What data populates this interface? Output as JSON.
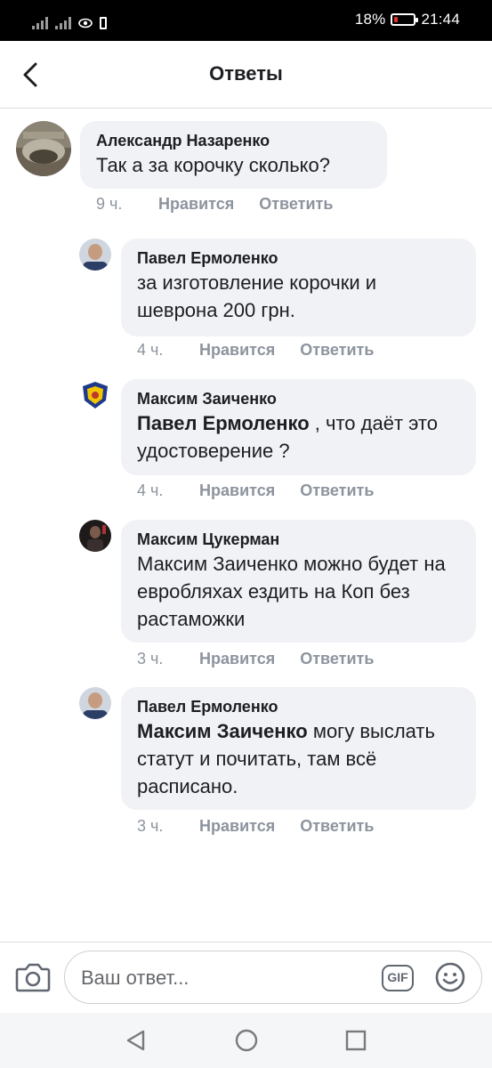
{
  "status_bar": {
    "battery": "18%",
    "battery_level": 0.18,
    "time": "21:44"
  },
  "header": {
    "title": "Ответы"
  },
  "comments": [
    {
      "author": "Александр Назаренко",
      "text": "Так а за корочку сколько?",
      "mention": "",
      "time": "9 ч.",
      "like": "Нравится",
      "reply": "Ответить"
    },
    {
      "author": "Павел Ермоленко",
      "text": "за изготовление корочки и шеврона 200 грн.",
      "mention": "",
      "time": "4 ч.",
      "like": "Нравится",
      "reply": "Ответить"
    },
    {
      "author": "Максим Заиченко",
      "mention": "Павел Ермоленко",
      "text": " , что даёт это удостоверение ?",
      "time": "4 ч.",
      "like": "Нравится",
      "reply": "Ответить"
    },
    {
      "author": "Максим Цукерман",
      "text": "Максим Заиченко можно будет на евробляхах ездить на Коп без растаможки",
      "mention": "",
      "time": "3 ч.",
      "like": "Нравится",
      "reply": "Ответить"
    },
    {
      "author": "Павел Ермоленко",
      "mention": "Максим Заиченко",
      "text": " могу выслать статут и почитать, там всё расписано.",
      "time": "3 ч.",
      "like": "Нравится",
      "reply": "Ответить"
    }
  ],
  "composer": {
    "placeholder": "Ваш ответ...",
    "gif_label": "GIF"
  },
  "icons": {
    "back": "chevron-left-icon",
    "camera": "camera-icon",
    "gif": "gif-icon",
    "emoji": "smiley-icon",
    "nav_back": "triangle-back-icon",
    "nav_home": "circle-home-icon",
    "nav_recent": "square-recent-icon"
  },
  "colors": {
    "bubble": "#f0f2f5",
    "meta": "#8d949e",
    "text": "#1c1e21",
    "battery_low": "#e3322b"
  }
}
